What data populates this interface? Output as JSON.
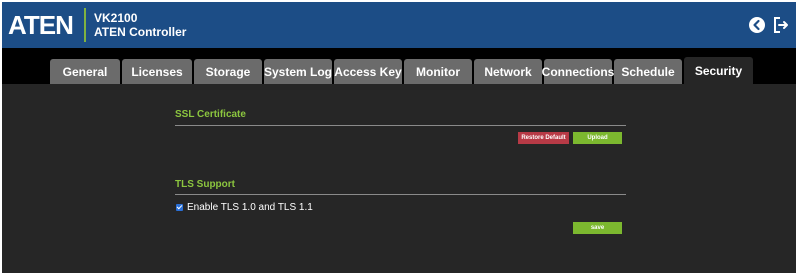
{
  "header": {
    "logo": "ATEN",
    "model": "VK2100",
    "subtitle": "ATEN Controller",
    "accent_color": "#1c4d86",
    "icons": [
      "back-icon",
      "logout-icon"
    ]
  },
  "tabs": [
    {
      "label": "General"
    },
    {
      "label": "Licenses"
    },
    {
      "label": "Storage"
    },
    {
      "label": "System Log"
    },
    {
      "label": "Access Key"
    },
    {
      "label": "Monitor"
    },
    {
      "label": "Network"
    },
    {
      "label": "Connections"
    },
    {
      "label": "Schedule"
    },
    {
      "label": "Security",
      "active": true
    }
  ],
  "ssl": {
    "title": "SSL Certificate",
    "restore_label": "Restore Default",
    "upload_label": "Upload"
  },
  "tls": {
    "title": "TLS Support",
    "checkbox_label": "Enable TLS 1.0 and TLS 1.1",
    "checked": true,
    "save_label": "save"
  },
  "colors": {
    "section_title": "#8cc63f",
    "restore_button": "#b73a46",
    "primary_button": "#7cb82f"
  }
}
